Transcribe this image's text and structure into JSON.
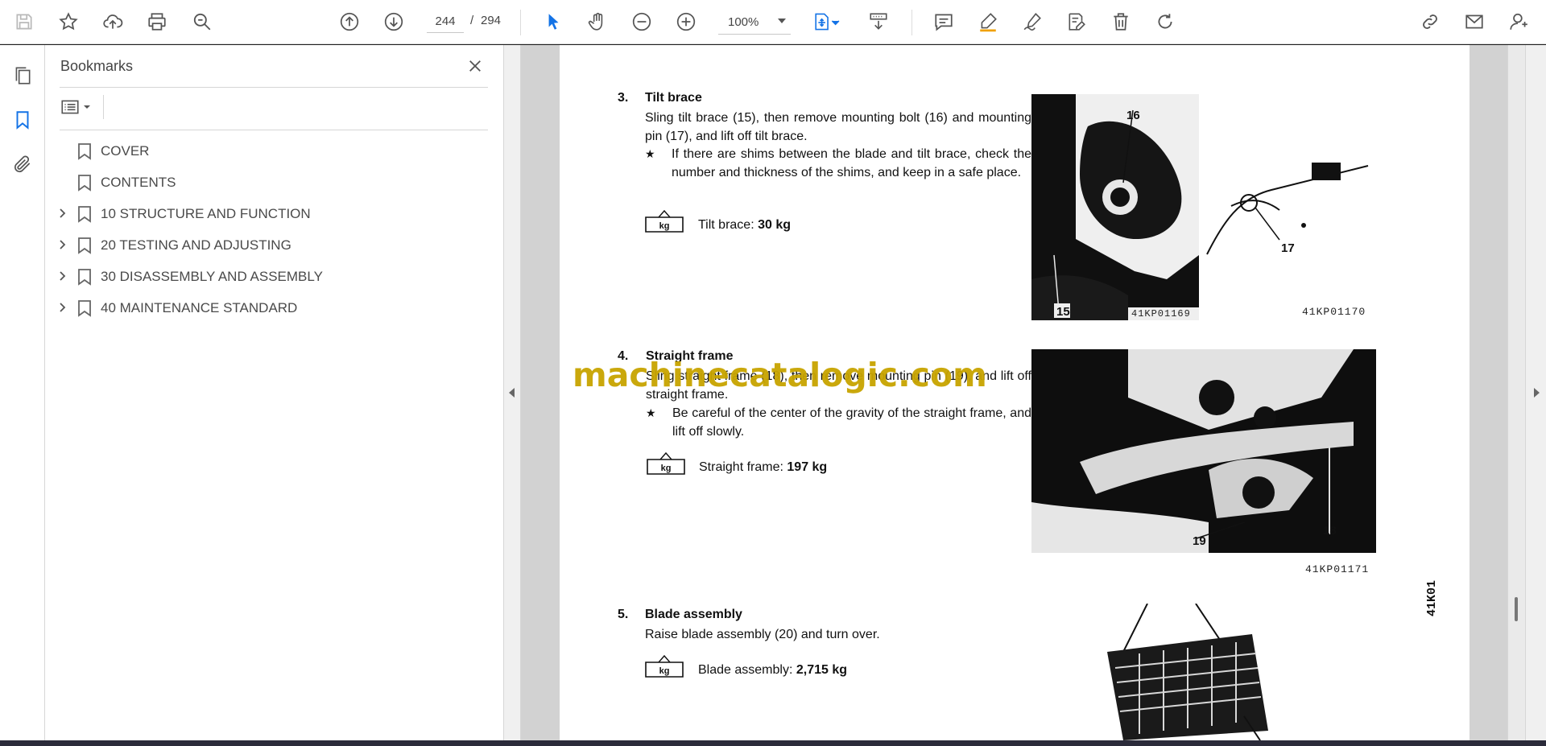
{
  "toolbar": {
    "page_current": "244",
    "page_separator": "/",
    "page_total": "294",
    "zoom": "100%",
    "accent_color": "#1473e6"
  },
  "bookmarks": {
    "title": "Bookmarks",
    "items": [
      {
        "label": "COVER",
        "expandable": false
      },
      {
        "label": "CONTENTS",
        "expandable": false
      },
      {
        "label": "10 STRUCTURE AND FUNCTION",
        "expandable": true
      },
      {
        "label": "20 TESTING AND ADJUSTING",
        "expandable": true
      },
      {
        "label": "30 DISASSEMBLY AND ASSEMBLY",
        "expandable": true
      },
      {
        "label": "40 MAINTENANCE STANDARD",
        "expandable": true
      }
    ]
  },
  "document": {
    "watermark": "machinecatalogic.com",
    "side_code": "41K01",
    "sections": [
      {
        "number": "3.",
        "title": "Tilt brace",
        "text": "Sling tilt brace (15), then remove mounting bolt (16) and mounting pin (17), and lift off tilt brace.",
        "note": "If there are shims between the blade and tilt brace, check the number and thickness of the shims, and keep in a safe place.",
        "weight_label": "Tilt brace:",
        "weight_value": "30 kg",
        "photos": [
          "41KP01169",
          "41KP01170"
        ],
        "callouts": [
          "15",
          "16",
          "17"
        ]
      },
      {
        "number": "4.",
        "title": "Straight frame",
        "text": "Sling straight frame (18), then remove mounting pin (19), and lift off straight frame.",
        "note": "Be careful of the center of the gravity of the straight frame, and lift off slowly.",
        "weight_label": "Straight frame:",
        "weight_value": "197 kg",
        "photos": [
          "41KP01171"
        ],
        "callouts": [
          "18",
          "19"
        ]
      },
      {
        "number": "5.",
        "title": "Blade assembly",
        "text": "Raise blade assembly (20) and turn over.",
        "weight_label": "Blade assembly:",
        "weight_value": "2,715 kg"
      }
    ],
    "kg_symbol": "kg",
    "note_marker": "★"
  }
}
